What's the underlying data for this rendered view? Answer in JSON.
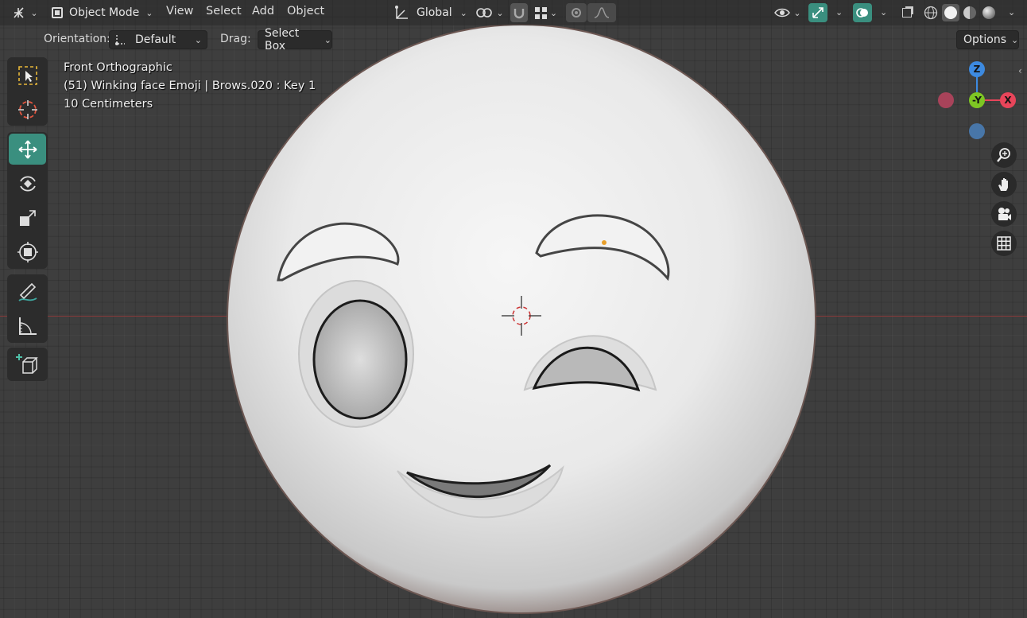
{
  "header": {
    "editor_type_icon": "move-axes-icon",
    "mode": "Object Mode",
    "menus": [
      "View",
      "Select",
      "Add",
      "Object"
    ],
    "transform_orientation": "Global"
  },
  "tool_settings": {
    "orientation_label": "Orientation:",
    "orientation_value": "Default",
    "drag_label": "Drag:",
    "drag_value": "Select Box",
    "options_label": "Options"
  },
  "viewport_info": {
    "view_name": "Front Orthographic",
    "object_info": "(51) Winking face Emoji | Brows.020 : Key 1",
    "scale": "10 Centimeters"
  },
  "gizmo": {
    "z_label": "Z",
    "y_label": "-Y",
    "x_label": "X",
    "colors": {
      "x": "#e8455a",
      "y": "#7ec623",
      "z": "#3d8ae0"
    }
  },
  "tools": [
    "select-box",
    "cursor",
    "move",
    "rotate",
    "scale",
    "transform",
    "annotate",
    "measure",
    "add-cube"
  ],
  "nav_buttons": [
    "zoom-icon",
    "pan-hand-icon",
    "camera-icon",
    "grid-view-icon"
  ],
  "colors": {
    "accent": "#3a8f7f",
    "viewport_bg": "#3e3e3e",
    "x_axis": "#8a3a3a"
  }
}
